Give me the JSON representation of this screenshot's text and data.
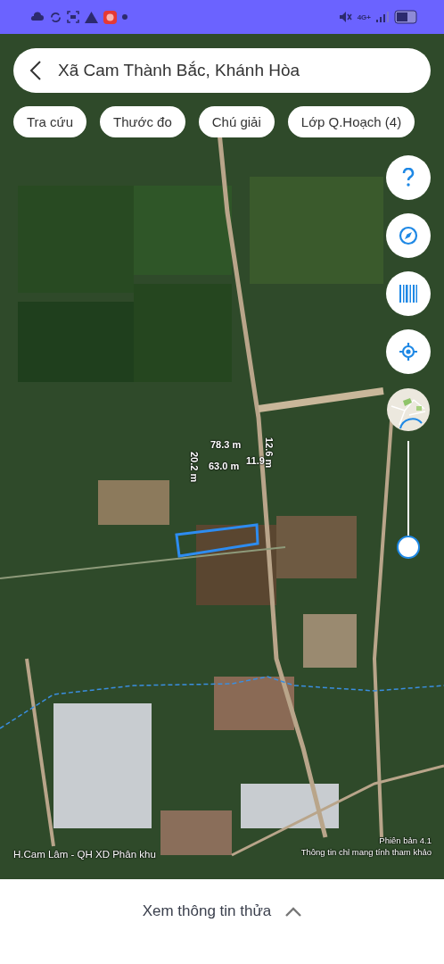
{
  "status_bar": {
    "network": "4G+"
  },
  "search_bar": {
    "title": "Xã Cam Thành Bắc, Khánh Hòa"
  },
  "chips": [
    {
      "label": "Tra cứu"
    },
    {
      "label": "Thước đo"
    },
    {
      "label": "Chú giải"
    },
    {
      "label": "Lớp Q.Hoạch (4)"
    }
  ],
  "map_tools": [
    {
      "kind": "help"
    },
    {
      "kind": "compass"
    },
    {
      "kind": "barcode"
    },
    {
      "kind": "locate"
    },
    {
      "kind": "basemap"
    }
  ],
  "opacity_slider": {
    "level": 0
  },
  "measurements": [
    {
      "text": "78.3 m",
      "kind": "horizontal"
    },
    {
      "text": "63.0 m",
      "kind": "horizontal"
    },
    {
      "text": "11.9",
      "kind": "horizontal"
    },
    {
      "text": "20.2 m",
      "kind": "vertical"
    },
    {
      "text": "12.6 m",
      "kind": "vertical"
    }
  ],
  "map_footer": {
    "layer": "H.Cam Lâm - QH XD Phân khu",
    "version": "Phiên bản 4.1",
    "disclaimer": "Thông tin chỉ mang tính tham khảo"
  },
  "bottom_sheet": {
    "label": "Xem thông tin thửa"
  }
}
